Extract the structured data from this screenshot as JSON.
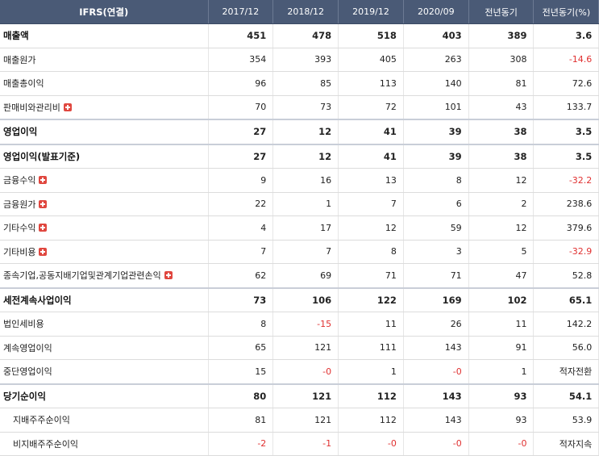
{
  "header": [
    "IFRS(연결)",
    "2017/12",
    "2018/12",
    "2019/12",
    "2020/09",
    "전년동기",
    "전년동기(%)"
  ],
  "rows": [
    {
      "label": "매출액",
      "bold": true,
      "values": [
        "451",
        "478",
        "518",
        "403",
        "389",
        "3.6"
      ],
      "neg": [
        false,
        false,
        false,
        false,
        false,
        false
      ]
    },
    {
      "label": "매출원가",
      "values": [
        "354",
        "393",
        "405",
        "263",
        "308",
        "-14.6"
      ],
      "neg": [
        false,
        false,
        false,
        false,
        false,
        true
      ]
    },
    {
      "label": "매출총이익",
      "values": [
        "96",
        "85",
        "113",
        "140",
        "81",
        "72.6"
      ],
      "neg": [
        false,
        false,
        false,
        false,
        false,
        false
      ]
    },
    {
      "label": "판매비와관리비",
      "expand": true,
      "values": [
        "70",
        "73",
        "72",
        "101",
        "43",
        "133.7"
      ],
      "neg": [
        false,
        false,
        false,
        false,
        false,
        false
      ]
    },
    {
      "label": "영업이익",
      "bold": true,
      "values": [
        "27",
        "12",
        "41",
        "39",
        "38",
        "3.5"
      ],
      "neg": [
        false,
        false,
        false,
        false,
        false,
        false
      ]
    },
    {
      "label": "영업이익(발표기준)",
      "bold": true,
      "values": [
        "27",
        "12",
        "41",
        "39",
        "38",
        "3.5"
      ],
      "neg": [
        false,
        false,
        false,
        false,
        false,
        false
      ]
    },
    {
      "label": "금융수익",
      "expand": true,
      "values": [
        "9",
        "16",
        "13",
        "8",
        "12",
        "-32.2"
      ],
      "neg": [
        false,
        false,
        false,
        false,
        false,
        true
      ]
    },
    {
      "label": "금융원가",
      "expand": true,
      "values": [
        "22",
        "1",
        "7",
        "6",
        "2",
        "238.6"
      ],
      "neg": [
        false,
        false,
        false,
        false,
        false,
        false
      ]
    },
    {
      "label": "기타수익",
      "expand": true,
      "values": [
        "4",
        "17",
        "12",
        "59",
        "12",
        "379.6"
      ],
      "neg": [
        false,
        false,
        false,
        false,
        false,
        false
      ]
    },
    {
      "label": "기타비용",
      "expand": true,
      "values": [
        "7",
        "7",
        "8",
        "3",
        "5",
        "-32.9"
      ],
      "neg": [
        false,
        false,
        false,
        false,
        false,
        true
      ]
    },
    {
      "label": "종속기업,공동지배기업및관계기업관련손익",
      "expand": true,
      "values": [
        "62",
        "69",
        "71",
        "71",
        "47",
        "52.8"
      ],
      "neg": [
        false,
        false,
        false,
        false,
        false,
        false
      ]
    },
    {
      "label": "세전계속사업이익",
      "bold": true,
      "values": [
        "73",
        "106",
        "122",
        "169",
        "102",
        "65.1"
      ],
      "neg": [
        false,
        false,
        false,
        false,
        false,
        false
      ]
    },
    {
      "label": "법인세비용",
      "values": [
        "8",
        "-15",
        "11",
        "26",
        "11",
        "142.2"
      ],
      "neg": [
        false,
        true,
        false,
        false,
        false,
        false
      ]
    },
    {
      "label": "계속영업이익",
      "values": [
        "65",
        "121",
        "111",
        "143",
        "91",
        "56.0"
      ],
      "neg": [
        false,
        false,
        false,
        false,
        false,
        false
      ]
    },
    {
      "label": "중단영업이익",
      "values": [
        "15",
        "-0",
        "1",
        "-0",
        "1",
        "적자전환"
      ],
      "neg": [
        false,
        true,
        false,
        true,
        false,
        false
      ]
    },
    {
      "label": "당기순이익",
      "bold": true,
      "values": [
        "80",
        "121",
        "112",
        "143",
        "93",
        "54.1"
      ],
      "neg": [
        false,
        false,
        false,
        false,
        false,
        false
      ]
    },
    {
      "label": "지배주주순이익",
      "sub": true,
      "values": [
        "81",
        "121",
        "112",
        "143",
        "93",
        "53.9"
      ],
      "neg": [
        false,
        false,
        false,
        false,
        false,
        false
      ]
    },
    {
      "label": "비지배주주순이익",
      "sub": true,
      "values": [
        "-2",
        "-1",
        "-0",
        "-0",
        "-0",
        "적자지속"
      ],
      "neg": [
        true,
        true,
        true,
        true,
        true,
        false
      ]
    }
  ],
  "colors": {
    "header_bg": "#4a5a76",
    "negative": "#e03030",
    "expand_icon": "#e0473f"
  }
}
